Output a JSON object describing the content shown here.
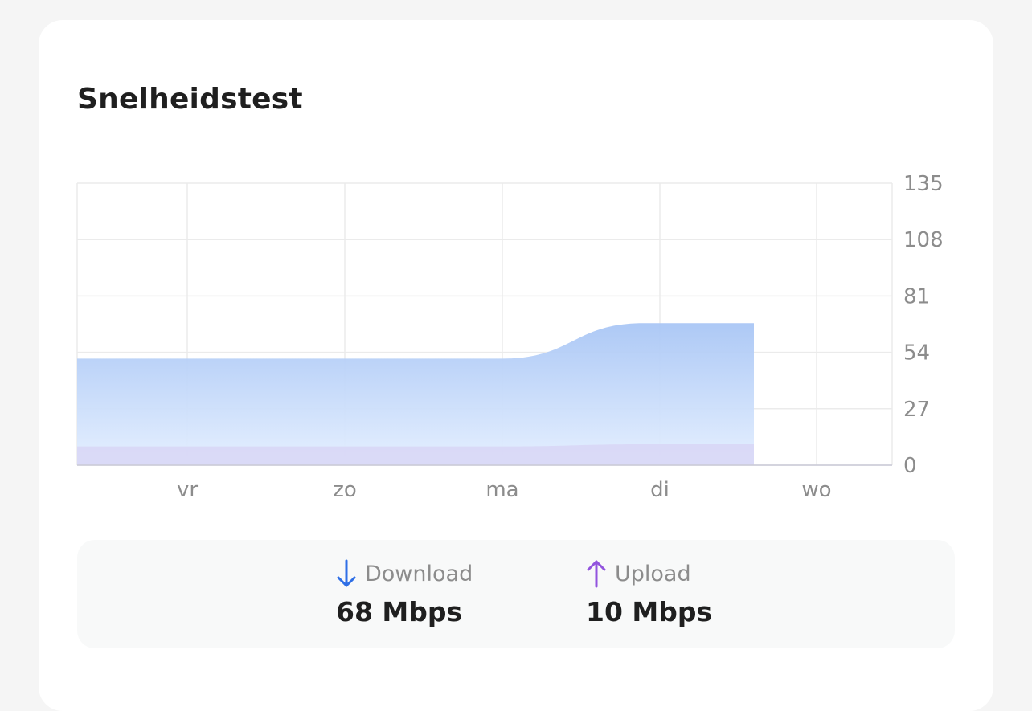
{
  "card": {
    "title": "Snelheidstest"
  },
  "chart_data": {
    "type": "area",
    "categories": [
      "vr",
      "zo",
      "ma",
      "di",
      "wo"
    ],
    "y_ticks": [
      "0",
      "27",
      "54",
      "81",
      "108",
      "135"
    ],
    "ylim": [
      0,
      135
    ],
    "axis_position": "right",
    "grid": true,
    "series": [
      {
        "name": "Download",
        "color": "#aac8f5",
        "values": [
          51,
          51,
          51,
          51,
          68,
          68
        ]
      },
      {
        "name": "Upload",
        "color": "#d8d6f6",
        "values": [
          9,
          9,
          9,
          9,
          10,
          10
        ]
      }
    ]
  },
  "legend": {
    "download": {
      "label": "Download",
      "value": "68 Mbps",
      "icon": "arrow-down-icon",
      "color": "#2f6fe6"
    },
    "upload": {
      "label": "Upload",
      "value": "10 Mbps",
      "icon": "arrow-up-icon",
      "color": "#9254de"
    }
  }
}
